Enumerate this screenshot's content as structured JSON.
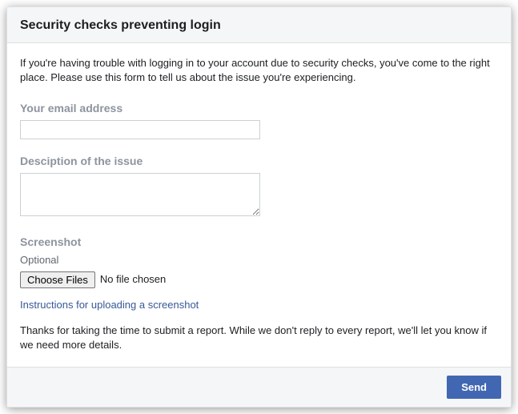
{
  "header": {
    "title": "Security checks preventing login"
  },
  "body": {
    "intro": "If you're having trouble with logging in to your account due to security checks, you've come to the right place. Please use this form to tell us about the issue you're experiencing.",
    "email_label": "Your email address",
    "email_value": "",
    "description_label": "Desciption of the issue",
    "description_value": "",
    "screenshot_label": "Screenshot",
    "optional_label": "Optional",
    "choose_files_label": "Choose Files",
    "file_status": "No file chosen",
    "instructions_link": "Instructions for uploading a screenshot",
    "thanks": "Thanks for taking the time to submit a report. While we don't reply to every report, we'll let you know if we need more details."
  },
  "footer": {
    "send_label": "Send"
  }
}
